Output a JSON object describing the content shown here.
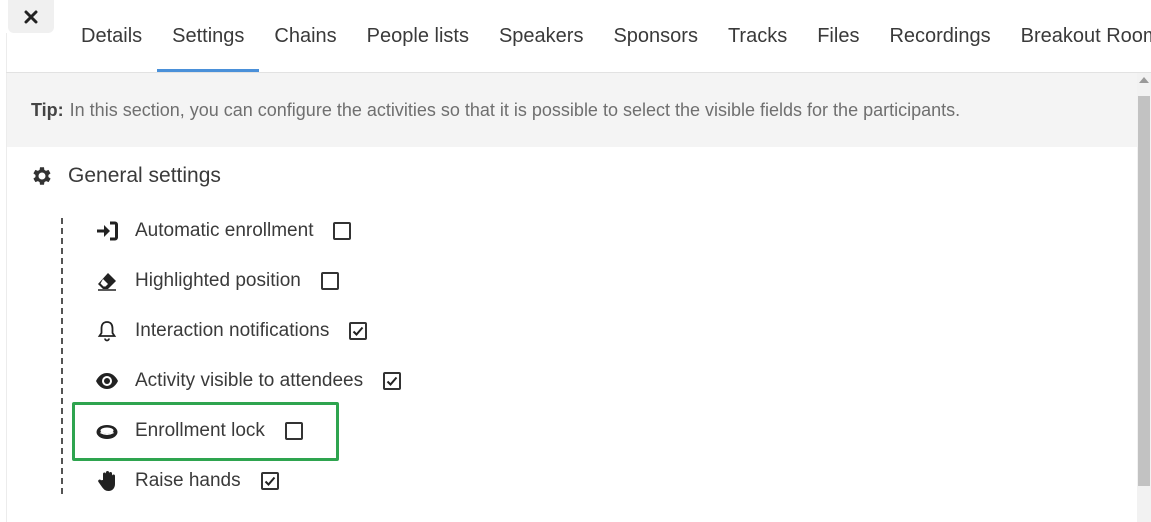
{
  "close_icon_glyph": "✕",
  "tabs": [
    {
      "label": "Details",
      "active": false
    },
    {
      "label": "Settings",
      "active": true
    },
    {
      "label": "Chains",
      "active": false
    },
    {
      "label": "People lists",
      "active": false
    },
    {
      "label": "Speakers",
      "active": false
    },
    {
      "label": "Sponsors",
      "active": false
    },
    {
      "label": "Tracks",
      "active": false
    },
    {
      "label": "Files",
      "active": false
    },
    {
      "label": "Recordings",
      "active": false
    },
    {
      "label": "Breakout Rooms",
      "active": false
    }
  ],
  "tip": {
    "label": "Tip:",
    "text": "In this section, you can configure the activities so that it is possible to select the visible fields for the participants."
  },
  "section": {
    "title": "General settings",
    "icon": "gear-icon"
  },
  "settings": [
    {
      "label": "Automatic enrollment",
      "icon": "sign-in-icon",
      "checked": false
    },
    {
      "label": "Highlighted position",
      "icon": "eraser-icon",
      "checked": false
    },
    {
      "label": "Interaction notifications",
      "icon": "bell-icon",
      "checked": true
    },
    {
      "label": "Activity visible to attendees",
      "icon": "eye-icon",
      "checked": true
    },
    {
      "label": "Enrollment lock",
      "icon": "lock-ring-icon",
      "checked": false
    },
    {
      "label": "Raise hands",
      "icon": "hand-icon",
      "checked": true
    }
  ],
  "colors": {
    "active_tab_underline": "#4a90d9",
    "highlight_border": "#2ea44f"
  }
}
